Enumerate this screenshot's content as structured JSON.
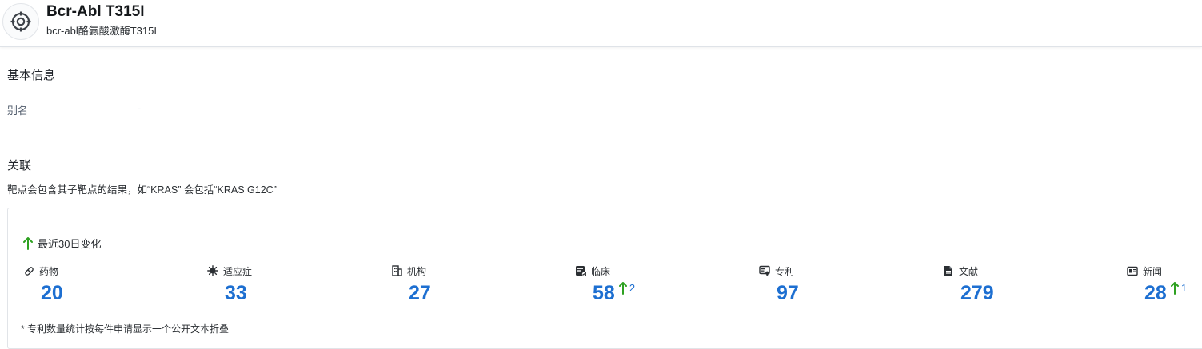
{
  "header": {
    "title": "Bcr-Abl T315I",
    "subtitle": "bcr-abl酪氨酸激酶T315I",
    "icon": "target-icon"
  },
  "basic_info": {
    "heading": "基本信息",
    "fields": [
      {
        "label": "别名",
        "value": "-"
      }
    ]
  },
  "association": {
    "heading": "关联",
    "note": "靶点会包含其子靶点的结果，如“KRAS” 会包括“KRAS G12C”",
    "change_label": "最近30日变化",
    "up_color": "#2ea121",
    "value_color": "#1d6fd1",
    "stats": [
      {
        "label": "药物",
        "value": "20",
        "icon": "pill-icon",
        "delta": ""
      },
      {
        "label": "适应症",
        "value": "33",
        "icon": "virus-icon",
        "delta": ""
      },
      {
        "label": "机构",
        "value": "27",
        "icon": "building-icon",
        "delta": ""
      },
      {
        "label": "临床",
        "value": "58",
        "icon": "clinical-icon",
        "delta": "2"
      },
      {
        "label": "专利",
        "value": "97",
        "icon": "patent-icon",
        "delta": ""
      },
      {
        "label": "文献",
        "value": "279",
        "icon": "document-icon",
        "delta": ""
      },
      {
        "label": "新闻",
        "value": "28",
        "icon": "news-icon",
        "delta": "1"
      }
    ],
    "footnote": "* 专利数量统计按每件申请显示一个公开文本折叠"
  }
}
